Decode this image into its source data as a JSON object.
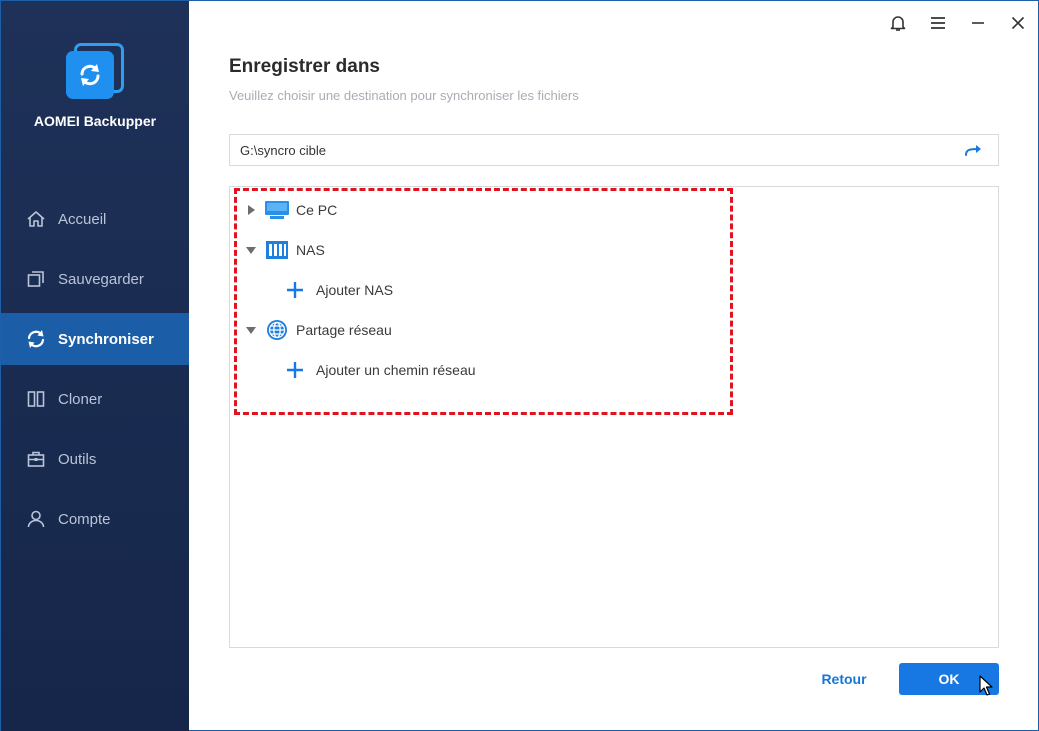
{
  "app": {
    "name": "AOMEI Backupper"
  },
  "nav": [
    {
      "label": "Accueil",
      "icon": "home-icon"
    },
    {
      "label": "Sauvegarder",
      "icon": "backup-icon"
    },
    {
      "label": "Synchroniser",
      "icon": "sync-icon",
      "active": true
    },
    {
      "label": "Cloner",
      "icon": "clone-icon"
    },
    {
      "label": "Outils",
      "icon": "toolbox-icon"
    },
    {
      "label": "Compte",
      "icon": "user-icon"
    }
  ],
  "dialog": {
    "title": "Enregistrer dans",
    "subtitle": "Veuillez choisir une destination pour synchroniser les fichiers",
    "path_value": "G:\\syncro cible"
  },
  "tree": {
    "ce_pc": "Ce PC",
    "nas": "NAS",
    "add_nas": "Ajouter NAS",
    "network_share": "Partage réseau",
    "add_network_path": "Ajouter un chemin réseau"
  },
  "buttons": {
    "back": "Retour",
    "ok": "OK"
  },
  "colors": {
    "sidebar": "#1e3158",
    "active_nav": "#1b5ea7",
    "accent": "#1778e3",
    "highlight": "#e0141e"
  }
}
